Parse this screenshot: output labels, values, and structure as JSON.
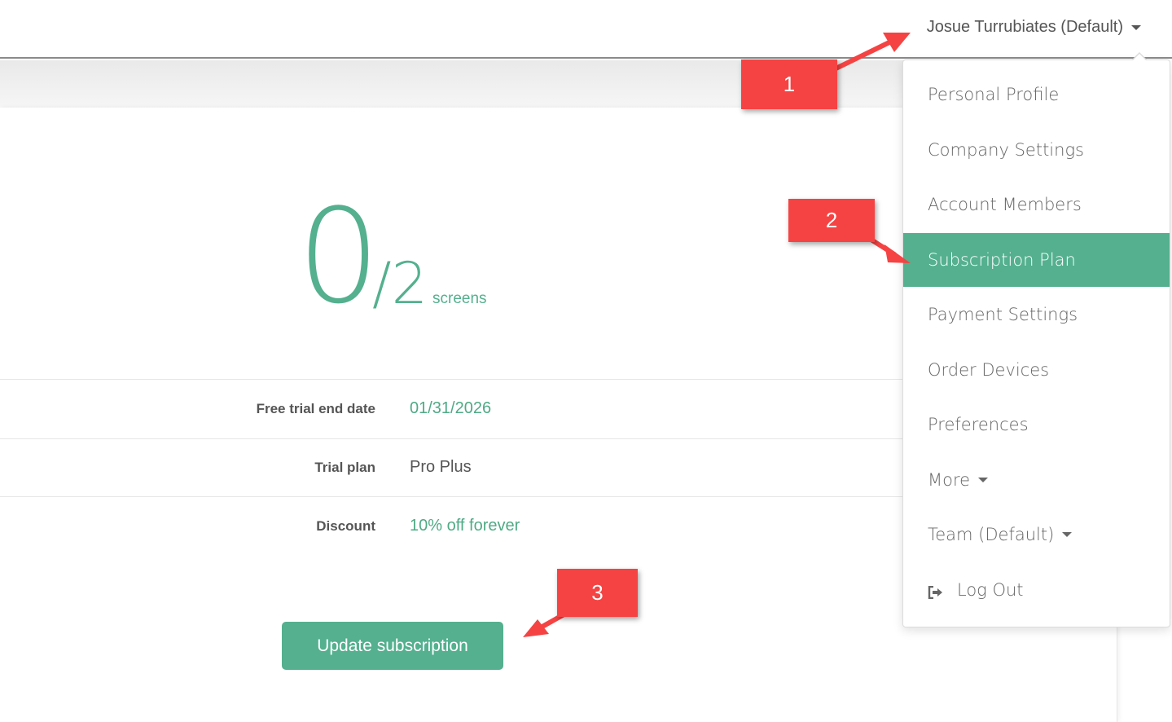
{
  "header": {
    "user_label": "Josue Turrubiates (Default)"
  },
  "screens": {
    "used": "0",
    "separator": "/",
    "total": "2",
    "unit": "screens"
  },
  "details": [
    {
      "label": "Free trial end date",
      "value": "01/31/2026"
    },
    {
      "label": "Trial plan",
      "value": "Pro Plus"
    },
    {
      "label": "Discount",
      "value": "10% off forever"
    }
  ],
  "actions": {
    "update_label": "Update subscription"
  },
  "menu": {
    "items": [
      {
        "label": "Personal Profile"
      },
      {
        "label": "Company Settings"
      },
      {
        "label": "Account Members"
      },
      {
        "label": "Subscription Plan",
        "active": true
      },
      {
        "label": "Payment Settings"
      },
      {
        "label": "Order Devices"
      },
      {
        "label": "Preferences"
      },
      {
        "label": "More",
        "has_caret": true
      },
      {
        "label": "Team (Default)",
        "has_caret": true
      },
      {
        "label": "Log Out",
        "icon": "log-out-icon"
      }
    ]
  },
  "annotations": [
    "1",
    "2",
    "3"
  ],
  "colors": {
    "accent": "#54b08f",
    "annotation": "#f54343"
  }
}
